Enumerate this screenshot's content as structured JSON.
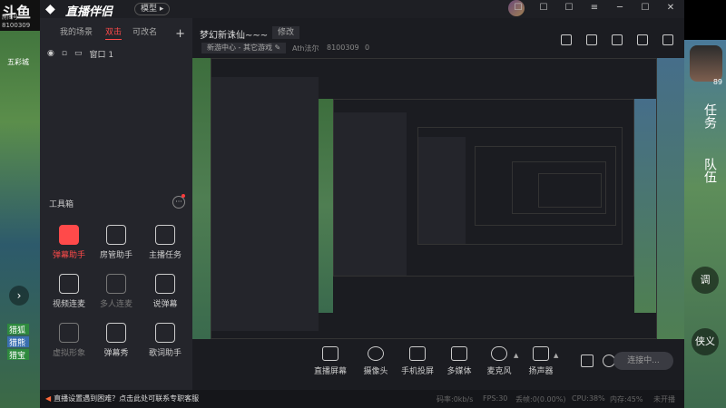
{
  "game_left": {
    "logo": "斗鱼",
    "logo_sub": "房间号",
    "room_number": "8100309",
    "area_label": "五彩城",
    "chips": [
      "猎狐",
      "猎熊",
      "猎宝"
    ],
    "nav_glyph": "›"
  },
  "game_right": {
    "badge": "89",
    "labels": [
      "任务",
      "队伍"
    ],
    "icons": [
      "调",
      "侠义"
    ]
  },
  "titlebar": {
    "app_title": "直播伴侣",
    "mode_label": "模型 ▸",
    "controls": [
      "☐",
      "☐",
      "☐",
      "≡",
      "─",
      "☐",
      "✕"
    ]
  },
  "left_panel": {
    "tabs": [
      "我的场景",
      "双击",
      "可改名"
    ],
    "active_tab": "双击",
    "scene_name": "窗口 1",
    "toolbox_label": "工具箱",
    "toolbox_more": "···",
    "tools": [
      {
        "label": "弹幕助手",
        "state": "active"
      },
      {
        "label": "房管助手",
        "state": "normal"
      },
      {
        "label": "主播任务",
        "state": "normal"
      },
      {
        "label": "视频连麦",
        "state": "normal"
      },
      {
        "label": "多人连麦",
        "state": "dim"
      },
      {
        "label": "说弹幕",
        "state": "normal"
      },
      {
        "label": "虚拟形象",
        "state": "dim"
      },
      {
        "label": "弹幕秀",
        "state": "normal"
      },
      {
        "label": "歌词助手",
        "state": "normal"
      }
    ]
  },
  "header": {
    "room_title": "梦幻新诛仙~~~",
    "edit_label": "修改",
    "category": "新游中心 - 其它游戏 ✎",
    "host_name": "Ath法尔",
    "room_id": "8100309",
    "heat": "0"
  },
  "controls": {
    "items": [
      "直播屏幕",
      "摄像头",
      "手机投屏",
      "多媒体",
      "麦克风",
      "扬声器"
    ],
    "live_button": "连接中..."
  },
  "statusbar": {
    "warning": "直播设置遇到困难？点击此处可联系专职客服",
    "stats": [
      "码率:0kb/s",
      "FPS:30",
      "丢帧:0(0.00%)",
      "CPU:38%",
      "内存:45%",
      "未开播"
    ]
  }
}
